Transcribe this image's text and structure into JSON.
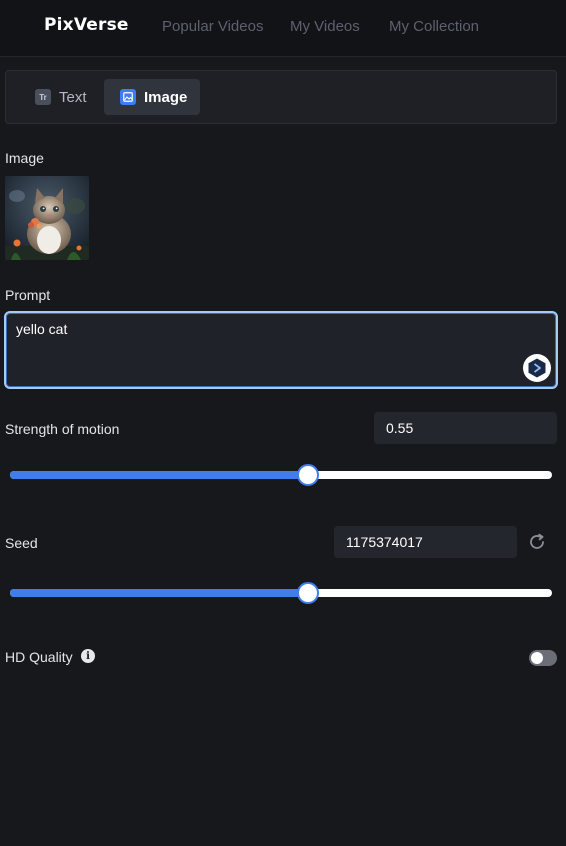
{
  "nav": {
    "logo": "PixVerse",
    "links": [
      "Popular Videos",
      "My Videos",
      "My Collection"
    ]
  },
  "tabs": {
    "items": [
      {
        "label": "Text",
        "icon": "text-type-icon",
        "active": false
      },
      {
        "label": "Image",
        "icon": "image-icon",
        "active": true
      }
    ]
  },
  "image_section": {
    "label": "Image",
    "thumbnail": "kitten-photo"
  },
  "prompt": {
    "label": "Prompt",
    "value": "yello cat",
    "enhance_icon": "prompt-enhance-icon"
  },
  "motion": {
    "label": "Strength of motion",
    "value": "0.55",
    "slider_fraction": 0.55
  },
  "seed": {
    "label": "Seed",
    "value": "1175374017",
    "slider_fraction": 0.55,
    "refresh_icon": "refresh-icon"
  },
  "hd": {
    "label": "HD Quality",
    "info_icon": "info-icon",
    "enabled": false
  },
  "colors": {
    "accent": "#3f7ee8",
    "background": "#17181c",
    "nav_background": "#121316"
  }
}
